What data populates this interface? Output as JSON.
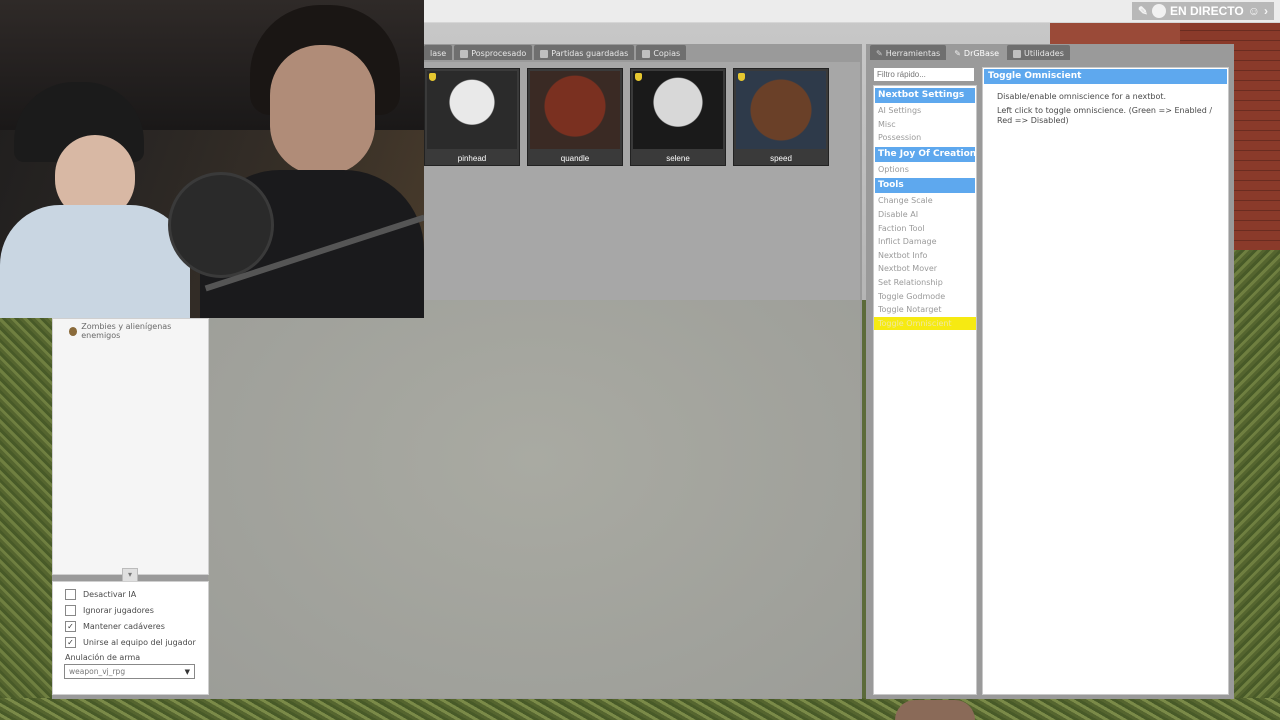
{
  "live_badge": {
    "label": "EN DIRECTO"
  },
  "spawn_tabs": [
    {
      "label": "lase",
      "icon": "tab-icon"
    },
    {
      "label": "Posprocesado",
      "icon": "tab-icon"
    },
    {
      "label": "Partidas guardadas",
      "icon": "tab-icon"
    },
    {
      "label": "Copias",
      "icon": "tab-icon"
    }
  ],
  "npc_cards": [
    {
      "name": "pinhead"
    },
    {
      "name": "quandle"
    },
    {
      "name": "selene"
    },
    {
      "name": "speed"
    }
  ],
  "npc_tree": {
    "item": "Zombies y alienígenas enemigos"
  },
  "npc_options": {
    "checkboxes": [
      {
        "label": "Desactivar IA",
        "checked": false
      },
      {
        "label": "Ignorar jugadores",
        "checked": false
      },
      {
        "label": "Mantener cadáveres",
        "checked": true
      },
      {
        "label": "Unirse al equipo del jugador",
        "checked": true
      }
    ],
    "weapon_label": "Anulación de arma",
    "weapon_value": "weapon_vj_rpg"
  },
  "right_tabs": [
    {
      "label": "Herramientas",
      "icon": "wrench-icon"
    },
    {
      "label": "DrGBase",
      "icon": "drgbase-icon"
    },
    {
      "label": "Utilidades",
      "icon": "utilities-icon"
    }
  ],
  "filter": {
    "placeholder": "Filtro rápido..."
  },
  "categories": [
    {
      "header": "Nextbot Settings",
      "items": [
        "AI Settings",
        "Misc",
        "Possession"
      ]
    },
    {
      "header": "The Joy Of Creation...",
      "items": [
        "Options"
      ]
    },
    {
      "header": "Tools",
      "items": [
        "Change Scale",
        "Disable AI",
        "Faction Tool",
        "Inflict Damage",
        "Nextbot Info",
        "Nextbot Mover",
        "Set Relationship",
        "Toggle Godmode",
        "Toggle Notarget",
        "Toggle Omniscient"
      ]
    }
  ],
  "selected_tool": "Toggle Omniscient",
  "tool_panel": {
    "title": "Toggle Omniscient",
    "desc1": "Disable/enable omniscience for a nextbot.",
    "desc2": "Left click to toggle omniscience. (Green => Enabled / Red => Disabled)"
  },
  "colors": {
    "header_blue": "#5ea8ee",
    "selected_yellow": "#f6ea12",
    "card_badge": "#e6c730"
  }
}
